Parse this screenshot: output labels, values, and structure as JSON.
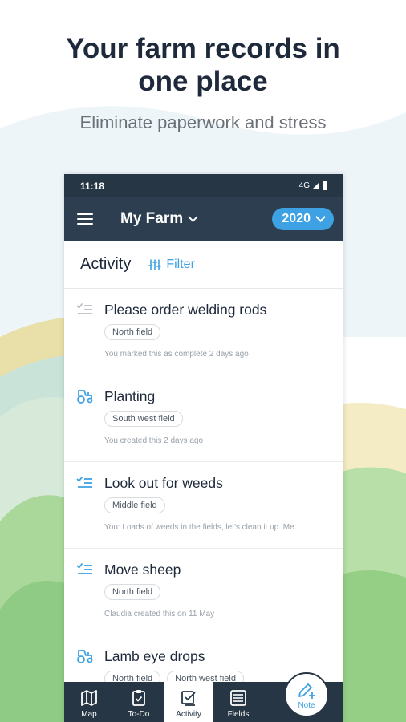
{
  "hero": {
    "title_line1": "Your farm records in",
    "title_line2": "one place",
    "subtitle": "Eliminate paperwork and stress"
  },
  "status_bar": {
    "time": "11:18",
    "network": "4G"
  },
  "app_bar": {
    "farm_name": "My Farm",
    "year": "2020"
  },
  "section": {
    "title": "Activity",
    "filter_label": "Filter"
  },
  "items": [
    {
      "icon": "task-done-icon",
      "icon_color": "#b9bec3",
      "title": "Please order welding rods",
      "tags": [
        "North field"
      ],
      "meta": "You marked this as complete 2 days ago"
    },
    {
      "icon": "tractor-icon",
      "icon_color": "#3da1e3",
      "title": "Planting",
      "tags": [
        "South west field"
      ],
      "meta": "You created this 2 days ago"
    },
    {
      "icon": "task-list-icon",
      "icon_color": "#3da1e3",
      "title": "Look out for weeds",
      "tags": [
        "Middle field"
      ],
      "meta": "You: Loads of weeds in the fields, let's clean it up. Me..."
    },
    {
      "icon": "task-list-icon",
      "icon_color": "#3da1e3",
      "title": "Move sheep",
      "tags": [
        "North field"
      ],
      "meta": "Claudia created this on 11 May"
    },
    {
      "icon": "tractor-icon",
      "icon_color": "#3da1e3",
      "title": "Lamb eye drops",
      "tags": [
        "North field",
        "North west field"
      ],
      "meta": ""
    }
  ],
  "nav": {
    "map": "Map",
    "todo": "To-Do",
    "activity": "Activity",
    "fields": "Fields",
    "note": "Note"
  },
  "colors": {
    "dark_navy": "#263645",
    "app_bar": "#2d3e50",
    "accent_blue": "#3da1e3",
    "heading": "#1e2a3b"
  }
}
